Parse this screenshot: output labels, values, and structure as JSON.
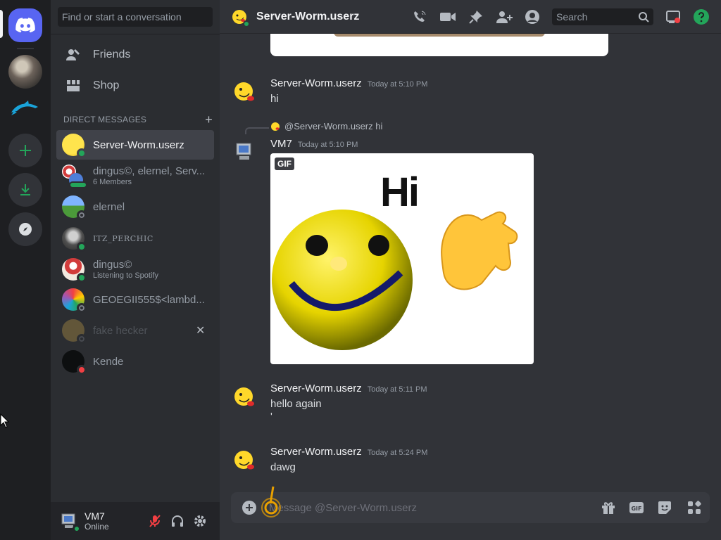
{
  "colors": {
    "blurple": "#5865f2",
    "online": "#23a55a",
    "dnd": "#f23f43",
    "green": "#23a55a"
  },
  "search": {
    "placeholder": "Find or start a conversation"
  },
  "nav": {
    "friends": "Friends",
    "shop": "Shop"
  },
  "dm_header": {
    "label": "Direct Messages",
    "add": "+"
  },
  "dms": [
    {
      "name": "Server-Worm.userz",
      "sub": "",
      "status": "online",
      "active": true
    },
    {
      "name": "dingus©, elernel, Serv...",
      "sub": "6 Members",
      "status": "group"
    },
    {
      "name": "elernel",
      "sub": "",
      "status": "offline"
    },
    {
      "name": "ITZ_PERCHIC",
      "sub": "",
      "status": "online"
    },
    {
      "name": "dingus©",
      "sub": "Listening to Spotify",
      "status": "online"
    },
    {
      "name": "GEOEGII555$<lambd...",
      "sub": "",
      "status": "offline"
    },
    {
      "name": "fake hecker",
      "sub": "",
      "status": "offline"
    },
    {
      "name": "Kende",
      "sub": "",
      "status": "dnd"
    }
  ],
  "user": {
    "name": "VM7",
    "status": "Online"
  },
  "topbar": {
    "title": "Server-Worm.userz",
    "search_placeholder": "Search"
  },
  "messages": [
    {
      "author": "Server-Worm.userz",
      "time": "Today at 5:10 PM",
      "text": "hi"
    },
    {
      "author": "VM7",
      "time": "Today at 5:10 PM",
      "reply": "@Server-Worm.userz hi",
      "gif_badge": "GIF",
      "gif_text": "Hi"
    },
    {
      "author": "Server-Worm.userz",
      "time": "Today at 5:11 PM",
      "text": "hello again",
      "text2": "'"
    },
    {
      "author": "Server-Worm.userz",
      "time": "Today at 5:24 PM",
      "text": "dawg"
    }
  ],
  "composer": {
    "placeholder": "Message @Server-Worm.userz"
  },
  "icons": [
    "discord-logo-icon",
    "plus-icon",
    "download-icon",
    "compass-icon",
    "friends-icon",
    "shop-icon",
    "phone-icon",
    "video-icon",
    "pin-icon",
    "add-friend-icon",
    "profile-icon",
    "search-icon",
    "inbox-icon",
    "help-icon",
    "mic-muted-icon",
    "headphones-icon",
    "gear-icon",
    "gift-icon",
    "gif-icon",
    "sticker-icon",
    "emoji-icon",
    "apps-icon"
  ]
}
